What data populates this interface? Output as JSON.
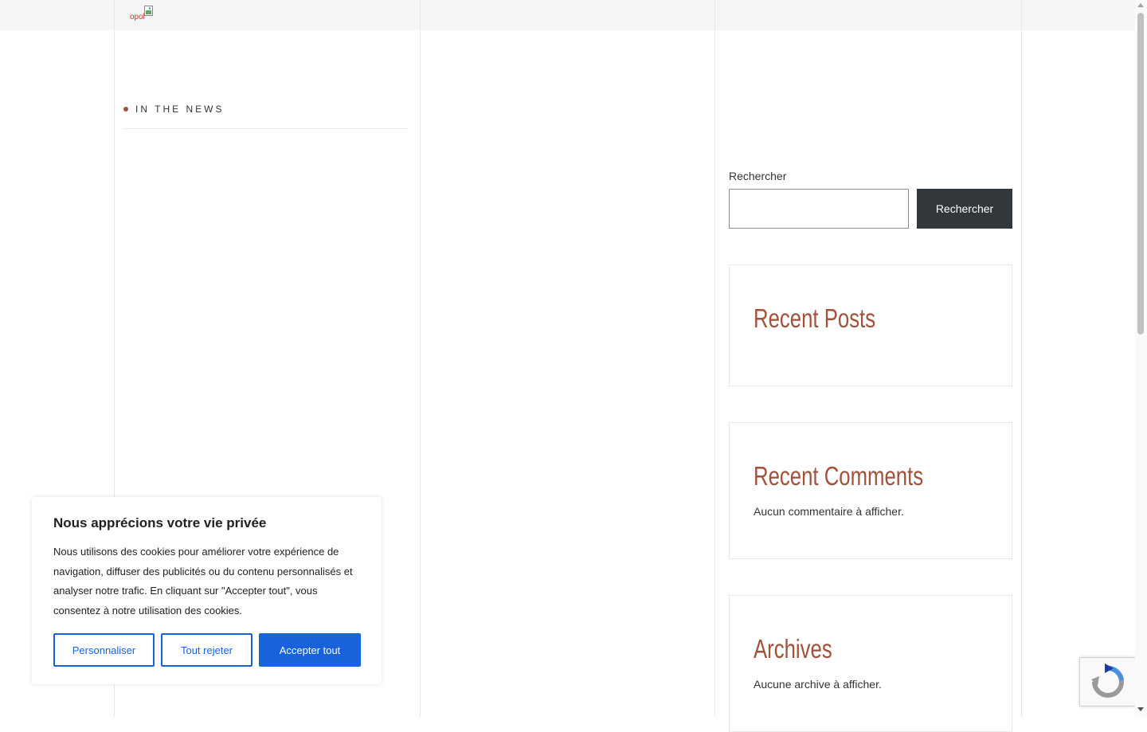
{
  "site": {
    "logo_text": "opol"
  },
  "news": {
    "heading": "IN THE NEWS"
  },
  "search": {
    "label": "Rechercher",
    "placeholder": "",
    "button_label": "Rechercher"
  },
  "widgets": {
    "recent_posts": {
      "title": "Recent Posts"
    },
    "recent_comments": {
      "title": "Recent Comments",
      "empty_text": "Aucun commentaire à afficher."
    },
    "archives": {
      "title": "Archives",
      "empty_text": "Aucune archive à afficher."
    }
  },
  "cookie_banner": {
    "title": "Nous apprécions votre vie privée",
    "text": "Nous utilisons des cookies pour améliorer votre expérience de navigation, diffuser des publicités ou du contenu personnalisés et analyser notre trafic. En cliquant sur \"Accepter tout\", vous consentez à notre utilisation des cookies.",
    "customize_label": "Personnaliser",
    "reject_label": "Tout rejeter",
    "accept_label": "Accepter tout"
  },
  "colors": {
    "accent": "#a0533c",
    "cookie_blue": "#1863dc",
    "button_dark": "#32373c"
  },
  "icons": {
    "recaptcha": "recaptcha-icon",
    "logo_image": "broken-image-icon"
  }
}
